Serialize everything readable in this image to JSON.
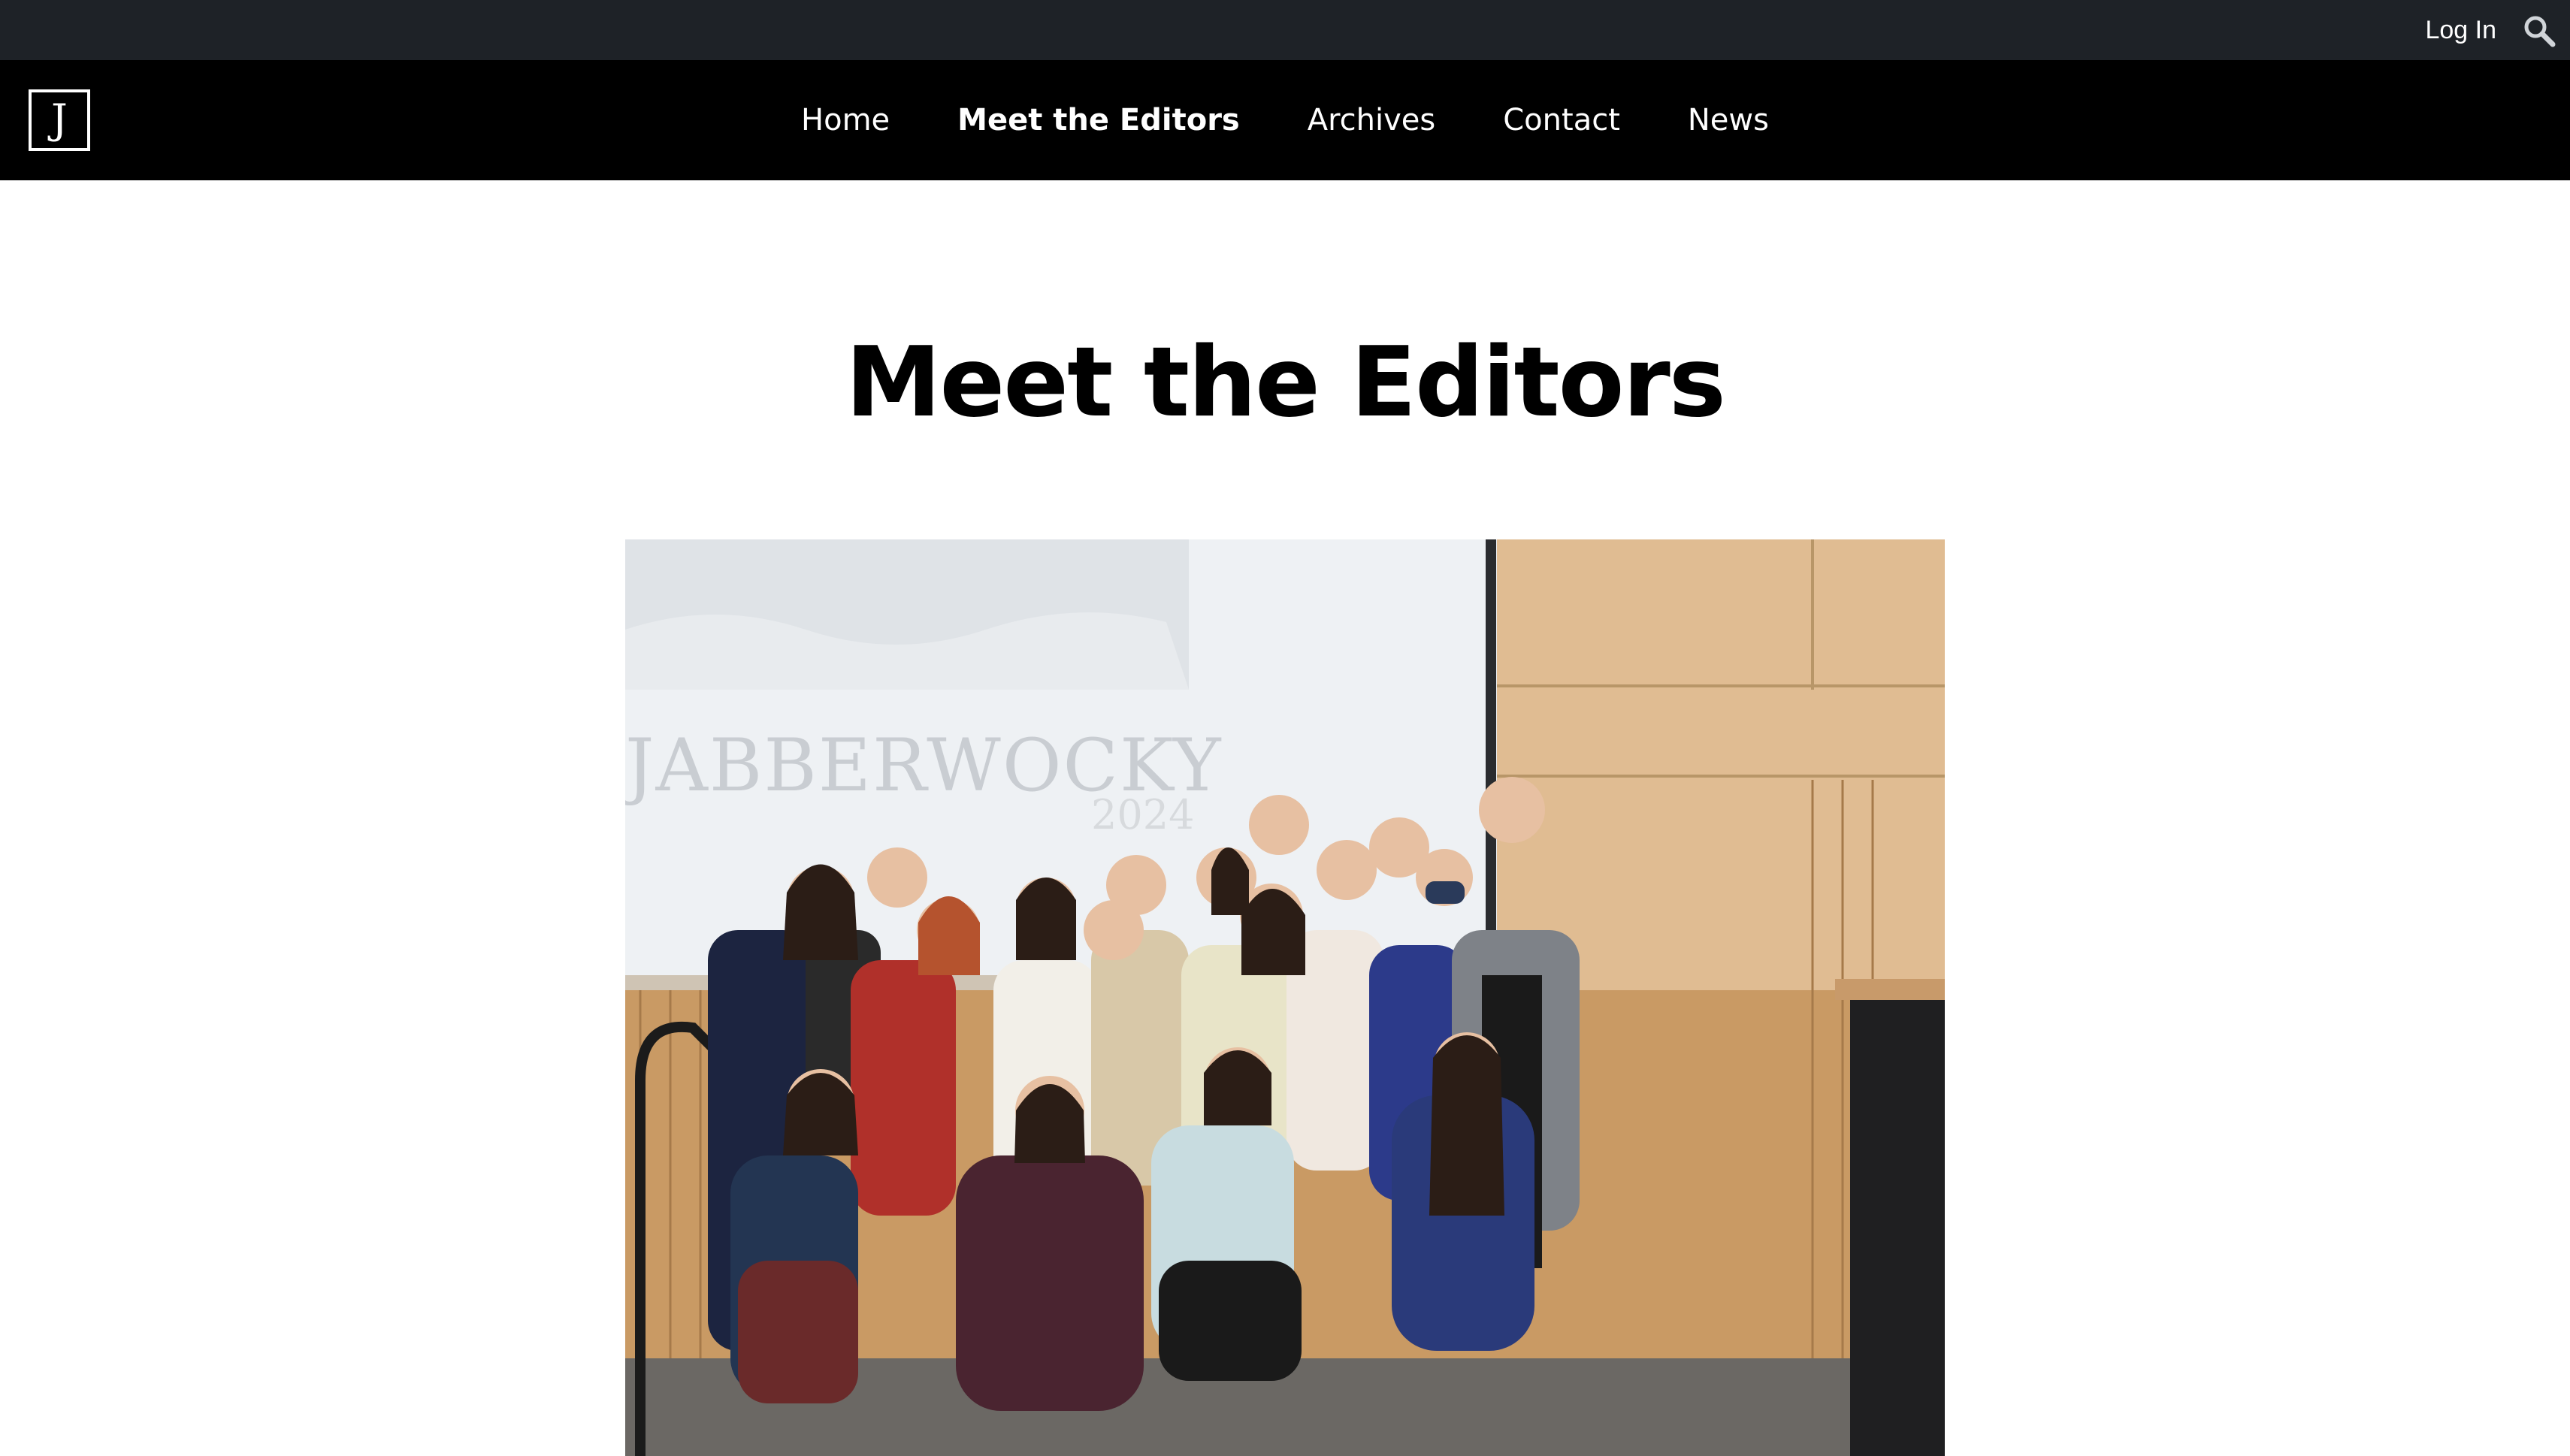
{
  "utility": {
    "login_label": "Log In",
    "search_icon": "search-icon"
  },
  "nav": {
    "logo_letter": "J",
    "items": [
      {
        "label": "Home",
        "active": false
      },
      {
        "label": "Meet the Editors",
        "active": true
      },
      {
        "label": "Archives",
        "active": false
      },
      {
        "label": "Contact",
        "active": false
      },
      {
        "label": "News",
        "active": false
      }
    ]
  },
  "page": {
    "title": "Meet the Editors"
  },
  "photo": {
    "screen_title": "JABBERWOCKY",
    "screen_year": "2024"
  },
  "colors": {
    "utility_bar": "#1e2227",
    "nav_bar": "#000000",
    "background": "#ffffff"
  }
}
